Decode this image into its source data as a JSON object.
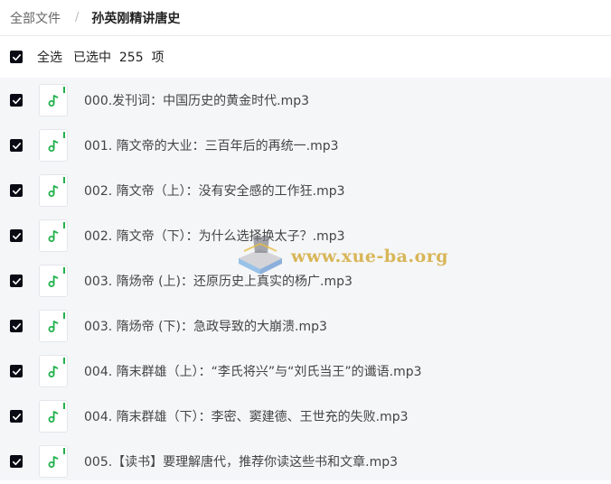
{
  "breadcrumb": {
    "root": "全部文件",
    "separator": "/",
    "current": "孙英刚精讲唐史"
  },
  "selection": {
    "select_all_label": "全选",
    "selected_text": "已选中  255  项"
  },
  "files": [
    {
      "name": "000.发刊词：中国历史的黄金时代.mp3",
      "checked": true,
      "icon": "audio-file-icon"
    },
    {
      "name": "001. 隋文帝的大业：三百年后的再统一.mp3",
      "checked": true,
      "icon": "audio-file-icon"
    },
    {
      "name": "002. 隋文帝（上）：没有安全感的工作狂.mp3",
      "checked": true,
      "icon": "audio-file-icon"
    },
    {
      "name": "002. 隋文帝（下）：为什么选择换太子？.mp3",
      "checked": true,
      "icon": "audio-file-icon"
    },
    {
      "name": "003. 隋炀帝 (上)：还原历史上真实的杨广.mp3",
      "checked": true,
      "icon": "audio-file-icon"
    },
    {
      "name": "003. 隋炀帝 (下)：急政导致的大崩溃.mp3",
      "checked": true,
      "icon": "audio-file-icon"
    },
    {
      "name": "004. 隋末群雄（上）：“李氏将兴”与“刘氏当王”的谶语.mp3",
      "checked": true,
      "icon": "audio-file-icon"
    },
    {
      "name": "004. 隋末群雄（下）：李密、窦建德、王世充的失败.mp3",
      "checked": true,
      "icon": "audio-file-icon"
    },
    {
      "name": "005.【读书】要理解唐代，推荐你读这些书和文章.mp3",
      "checked": true,
      "icon": "audio-file-icon"
    }
  ],
  "watermark": {
    "text": "www.xue-ba.org"
  },
  "colors": {
    "checkbox": "#0a0a14",
    "audio_icon": "#22b14c",
    "list_background": "#f5f6f8"
  }
}
